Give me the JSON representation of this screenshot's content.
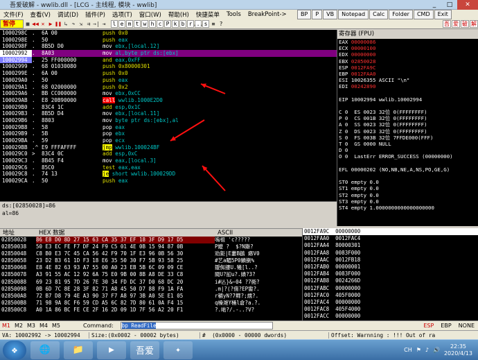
{
  "window": {
    "title": "吾爱破解 - wwlib.dll - [LCG - 主线程, 模块 - wwlib]",
    "controls": [
      "_",
      "□",
      "✕"
    ]
  },
  "menu": [
    "文件(F)",
    "查看(V)",
    "调试(D)",
    "插件(P)",
    "选项(T)",
    "窗口(W)",
    "帮助(H)",
    "快捷菜单",
    "Tools",
    "BreakPoint->"
  ],
  "plugins": [
    "BP",
    "P",
    "VB",
    "Notepad",
    "Calc",
    "Folder",
    "CMD",
    "Exit"
  ],
  "toolbar": {
    "status": "暂停",
    "letters": [
      "l",
      "e",
      "m",
      "t",
      "w",
      "h",
      "c",
      "P",
      "k",
      "b",
      "r",
      "...",
      "s"
    ],
    "extras": [
      "≡",
      "?"
    ],
    "cn": [
      "吾",
      "爱",
      "破",
      "解"
    ]
  },
  "cpu_rows": [
    {
      "addr": "1000298C",
      "mk": ".",
      "hex": "6A 00",
      "dis": [
        [
          "k-push",
          "push "
        ],
        [
          "imm",
          "0x0"
        ]
      ]
    },
    {
      "addr": "1000298E",
      "mk": ".",
      "hex": "50",
      "dis": [
        [
          "k-push",
          "push "
        ],
        [
          "op",
          "eax"
        ]
      ]
    },
    {
      "addr": "1000298F",
      "mk": ".",
      "hex": "8B5D D0",
      "dis": [
        [
          "k-mov",
          "mov "
        ],
        [
          "op",
          "ebx,[local.12]"
        ]
      ]
    },
    {
      "addr": "10002992",
      "mk": ".",
      "hex": "8A03",
      "dis": [
        [
          "k-mov",
          "mov "
        ],
        [
          "op",
          "al,byte ptr ds:[ebx]"
        ]
      ],
      "state": "sel"
    },
    {
      "addr": "10002994",
      "mk": ".",
      "hex": "25 FF000000",
      "dis": [
        [
          "k-and",
          "and "
        ],
        [
          "op",
          "eax,0xFF"
        ]
      ],
      "state": "cur"
    },
    {
      "addr": "10002999",
      "mk": ".",
      "hex": "68 01030080",
      "dis": [
        [
          "k-push",
          "push "
        ],
        [
          "imm",
          "0x80000301"
        ]
      ]
    },
    {
      "addr": "1000299E",
      "mk": ".",
      "hex": "6A 00",
      "dis": [
        [
          "k-push",
          "push "
        ],
        [
          "imm",
          "0x0"
        ]
      ]
    },
    {
      "addr": "100029A0",
      "mk": ".",
      "hex": "50",
      "dis": [
        [
          "k-push",
          "push "
        ],
        [
          "op",
          "eax"
        ]
      ]
    },
    {
      "addr": "100029A1",
      "mk": ".",
      "hex": "68 02000000",
      "dis": [
        [
          "k-push",
          "push "
        ],
        [
          "imm",
          "0x2"
        ]
      ]
    },
    {
      "addr": "100029A6",
      "mk": ".",
      "hex": "BB CC000000",
      "dis": [
        [
          "k-mov",
          "mov "
        ],
        [
          "op",
          "ebx,0xCC"
        ]
      ]
    },
    {
      "addr": "100029AB",
      "mk": ".",
      "hex": "E8 20B90000",
      "dis": [
        [
          "k-call",
          "call"
        ],
        [
          "op",
          " wwlib.1000E2D0"
        ]
      ]
    },
    {
      "addr": "100029B0",
      "mk": ".",
      "hex": "83C4 1C",
      "dis": [
        [
          "k-add",
          "add "
        ],
        [
          "op",
          "esp,0x1C"
        ]
      ]
    },
    {
      "addr": "100029B3",
      "mk": ".",
      "hex": "8B5D D4",
      "dis": [
        [
          "k-mov",
          "mov "
        ],
        [
          "op",
          "ebx,[local.11]"
        ]
      ]
    },
    {
      "addr": "100029B6",
      "mk": ".",
      "hex": "8803",
      "dis": [
        [
          "k-mov",
          "mov "
        ],
        [
          "op",
          "byte ptr ds:[ebx],al"
        ]
      ]
    },
    {
      "addr": "100029B8",
      "mk": ".",
      "hex": "58",
      "dis": [
        [
          "k-pop",
          "pop "
        ],
        [
          "op",
          "eax"
        ]
      ]
    },
    {
      "addr": "100029B9",
      "mk": ".",
      "hex": "5B",
      "dis": [
        [
          "k-pop",
          "pop "
        ],
        [
          "op",
          "ebx"
        ]
      ]
    },
    {
      "addr": "100029BA",
      "mk": ".",
      "hex": "59",
      "dis": [
        [
          "k-pop",
          "pop "
        ],
        [
          "op",
          "ecx"
        ]
      ]
    },
    {
      "addr": "100029BB",
      "mk": ".^",
      "hex": "E9 FFFAFFFF",
      "dis": [
        [
          "k-jmp",
          "jmp"
        ],
        [
          "op",
          " wwlib.100024BF"
        ]
      ]
    },
    {
      "addr": "100029C0",
      "mk": ">",
      "hex": "83C4 0C",
      "dis": [
        [
          "k-add",
          "add "
        ],
        [
          "op",
          "esp,0xC"
        ]
      ]
    },
    {
      "addr": "100029C3",
      "mk": ".",
      "hex": "8B45 F4",
      "dis": [
        [
          "k-mov",
          "mov "
        ],
        [
          "op",
          "eax,[local.3]"
        ]
      ]
    },
    {
      "addr": "100029C6",
      "mk": ".",
      "hex": "85C0",
      "dis": [
        [
          "k-test",
          "test "
        ],
        [
          "op",
          "eax,eax"
        ]
      ]
    },
    {
      "addr": "100029C8",
      "mk": ".",
      "hex": "74 13",
      "dis": [
        [
          "k-jcc",
          "je"
        ],
        [
          "op",
          " short wwlib.100029DD"
        ]
      ]
    },
    {
      "addr": "100029CA",
      "mk": ".",
      "hex": "50",
      "dis": [
        [
          "k-push",
          "push "
        ],
        [
          "op",
          "eax"
        ]
      ]
    }
  ],
  "info": [
    "ds:[02850028]=86",
    "al=86"
  ],
  "regs_title": "寄存器 (FPU)",
  "regs": [
    {
      "t": "EAX ",
      "v": "00000086",
      "red": true
    },
    {
      "t": "ECX ",
      "v": "00000100",
      "red": true
    },
    {
      "t": "EDX ",
      "v": "00000000",
      "red": true
    },
    {
      "t": "EBX ",
      "v": "02850028",
      "red": true
    },
    {
      "t": "ESP ",
      "v": "0012FA9C",
      "red": true
    },
    {
      "t": "EBP ",
      "v": "0012FAA0",
      "red": true
    },
    {
      "t": "ESI ",
      "v": "10026355 ASCII \"\\n\"",
      "red": false
    },
    {
      "t": "EDI ",
      "v": "00242890",
      "red": true
    },
    {
      "t": "",
      "v": "",
      "red": false
    },
    {
      "t": "EIP ",
      "v": "10002994 wwlib.10002994",
      "red": false
    },
    {
      "t": "",
      "v": "",
      "red": false
    },
    {
      "t": "C 0  ES 0023 32位 0(FFFFFFFF)",
      "v": "",
      "red": false
    },
    {
      "t": "P 0  CS 001B 32位 0(FFFFFFFF)",
      "v": "",
      "red": false
    },
    {
      "t": "A 0  SS 0023 32位 0(FFFFFFFF)",
      "v": "",
      "red": false
    },
    {
      "t": "Z 0  DS 0023 32位 0(FFFFFFFF)",
      "v": "",
      "red": false
    },
    {
      "t": "S 0  FS 003B 32位 7FFDE000(FFF)",
      "v": "",
      "red": false
    },
    {
      "t": "T 0  GS 0000 NULL",
      "v": "",
      "red": false
    },
    {
      "t": "D 0",
      "v": "",
      "red": false
    },
    {
      "t": "O 0  LastErr ERROR_SUCCESS (00000000)",
      "v": "",
      "red": false
    },
    {
      "t": "",
      "v": "",
      "red": false
    },
    {
      "t": "EFL 00000202 (NO,NB,NE,A,NS,PO,GE,G)",
      "v": "",
      "red": false
    },
    {
      "t": "",
      "v": "",
      "red": false
    },
    {
      "t": "ST0 empty 0.0",
      "v": "",
      "red": false
    },
    {
      "t": "ST1 empty 0.0",
      "v": "",
      "red": false
    },
    {
      "t": "ST2 empty 0.0",
      "v": "",
      "red": false
    },
    {
      "t": "ST3 empty 0.0",
      "v": "",
      "red": false
    },
    {
      "t": "ST4 empty 1.0000000000000000000",
      "v": "",
      "red": false
    }
  ],
  "dump_header": {
    "addr": "地址",
    "hex": "HEX 数据",
    "ascii": "ASCII"
  },
  "dump": [
    {
      "a": "02850028",
      "h": "86 E8 D0 8D 27 15 63 CA 35 37 EF 18 3F D9 17 D5",
      "t": "嗚祖 'c?????"
    },
    {
      "a": "02850038",
      "h": "50 E3 EC FE F7 DF 24 F9 C5 01 4E 0B 15 94 87 0B",
      "t": "P嬤 ?  $?N鏩?"
    },
    {
      "a": "02850048",
      "h": "C8 B0 E3 7C 45 CA 56 42 F9 70 1F E3 96 0B 56 30",
      "t": "劝鉅|E蔞B鵳 瘱V0"
    },
    {
      "a": "02850058",
      "h": "23 D2 B3 61 1D F3 18 E6 35 50 30 F7 5B 93 58 25",
      "t": "#艺a睸5P0鱗揦%"
    },
    {
      "a": "02850068",
      "h": "E8 4E 82 63 93 A7 55 00 A0 23 EB 5B 6C 09 09 CE",
      "t": "鑀倁摟U.犧[l..?"
    },
    {
      "a": "02850078",
      "h": "A3 91 55 AC 12 92 6A 75 E0 9B 00 8B A8 DE 33 C8",
      "t": "閥U?抝u?.嫧?3?"
    },
    {
      "a": "02850088",
      "h": "69 23 81 95 7D 26 7E 30 34 FD DC 37 D0 68 DC 20",
      "t": "i#亾}&~04 ?7衕?"
    },
    {
      "a": "02850098",
      "h": "0B 6D 7C 8E 28 3F 82 71 A8 45 50 D7 88 F9 1A FA",
      "t": ".m|?(?俼?EP讏?."
    },
    {
      "a": "028500A8",
      "h": "72 B7 D8 79 4E A3 90 37 F7 A8 97 3B A0 5E E1 05",
      "t": "r穱yN?7鳏?;燸?."
    },
    {
      "a": "028500B8",
      "h": "71 98 9A 8C F6 59 CD A5 6C 82 7D 80 61 0A F4 15",
      "t": "q槡滟Y桶l倉?a.?."
    },
    {
      "a": "028500C8",
      "h": "A0 1A 86 BC FE CE 2F 16 2D 09 1D 7F 56 A2 20 F1",
      "t": "?.喖?/.-..?V?"
    }
  ],
  "stack": [
    "0012FA9C  00000000",
    "0012FAA0  0012FAC4",
    "0012FAA4  80000301",
    "0012FAA8  0083F000",
    "0012FAAC  0012FB18",
    "0012FAB0  00000001",
    "0012FAB4  0083F000",
    "0012FAB8  0024266D",
    "0012FABC  00000000",
    "0012FAC0  405F0000",
    "0012FAC4  00000000",
    "0012FAC8  405F4000",
    "0012FACC  00000000"
  ],
  "cmdbar": {
    "modes": [
      "M1",
      "M2",
      "M3",
      "M4",
      "M5"
    ],
    "command_label": "Command:",
    "command_value": "bp ReadFile",
    "right": [
      "ESP",
      "EBP",
      "NONE"
    ]
  },
  "statusbar": [
    "VA: 10002992 -> 10002994",
    "Size:(0x0002 - 00002 bytes)",
    "#  (0x0000 - 00000 dwords)",
    "Offset: Warnning : !!! Out of ra"
  ],
  "taskbar": {
    "start_icon": "❖",
    "buttons": [
      "🌐",
      "📁",
      "▶",
      "吾爱",
      "✦"
    ],
    "tray": [
      "CH",
      "⚑",
      "♪",
      "🔊"
    ],
    "time": "22:35",
    "date": "2020/4/13"
  },
  "arrows": {
    "color": "#ff1010"
  }
}
